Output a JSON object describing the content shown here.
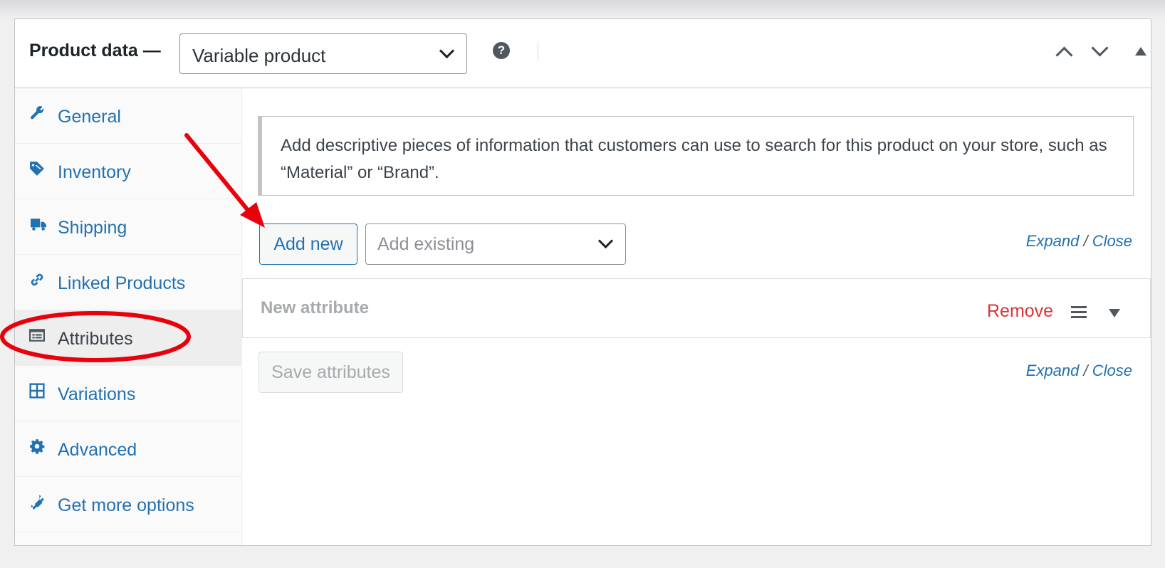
{
  "header": {
    "title": "Product data —",
    "product_type": "Variable product",
    "help_icon": "question-circle-icon",
    "help_glyph": "?",
    "controls": [
      "chevron-up-icon",
      "chevron-down-icon",
      "collapse-triangle-icon"
    ]
  },
  "tabs": [
    {
      "label": "General",
      "icon": "wrench-icon",
      "active": false
    },
    {
      "label": "Inventory",
      "icon": "tag-icon",
      "active": false
    },
    {
      "label": "Shipping",
      "icon": "truck-icon",
      "active": false
    },
    {
      "label": "Linked Products",
      "icon": "link-icon",
      "active": false
    },
    {
      "label": "Attributes",
      "icon": "list-card-icon",
      "active": true
    },
    {
      "label": "Variations",
      "icon": "grid-icon",
      "active": false
    },
    {
      "label": "Advanced",
      "icon": "gear-icon",
      "active": false
    },
    {
      "label": "Get more options",
      "icon": "plugin-icon",
      "active": false
    }
  ],
  "notice": {
    "text": "Add descriptive pieces of information that customers can use to search for this product on your store, such as “Material” or “Brand”."
  },
  "toolbar": {
    "add_new_label": "Add new",
    "add_existing_placeholder": "Add existing",
    "expand_label": "Expand",
    "separator": "/",
    "close_label": "Close"
  },
  "attribute": {
    "name": "New attribute",
    "remove_label": "Remove"
  },
  "footer": {
    "save_label": "Save attributes",
    "expand_label": "Expand",
    "separator": "/",
    "close_label": "Close"
  },
  "colors": {
    "link": "#2271b1",
    "remove": "#d63638",
    "annotation": "#e8000d"
  }
}
